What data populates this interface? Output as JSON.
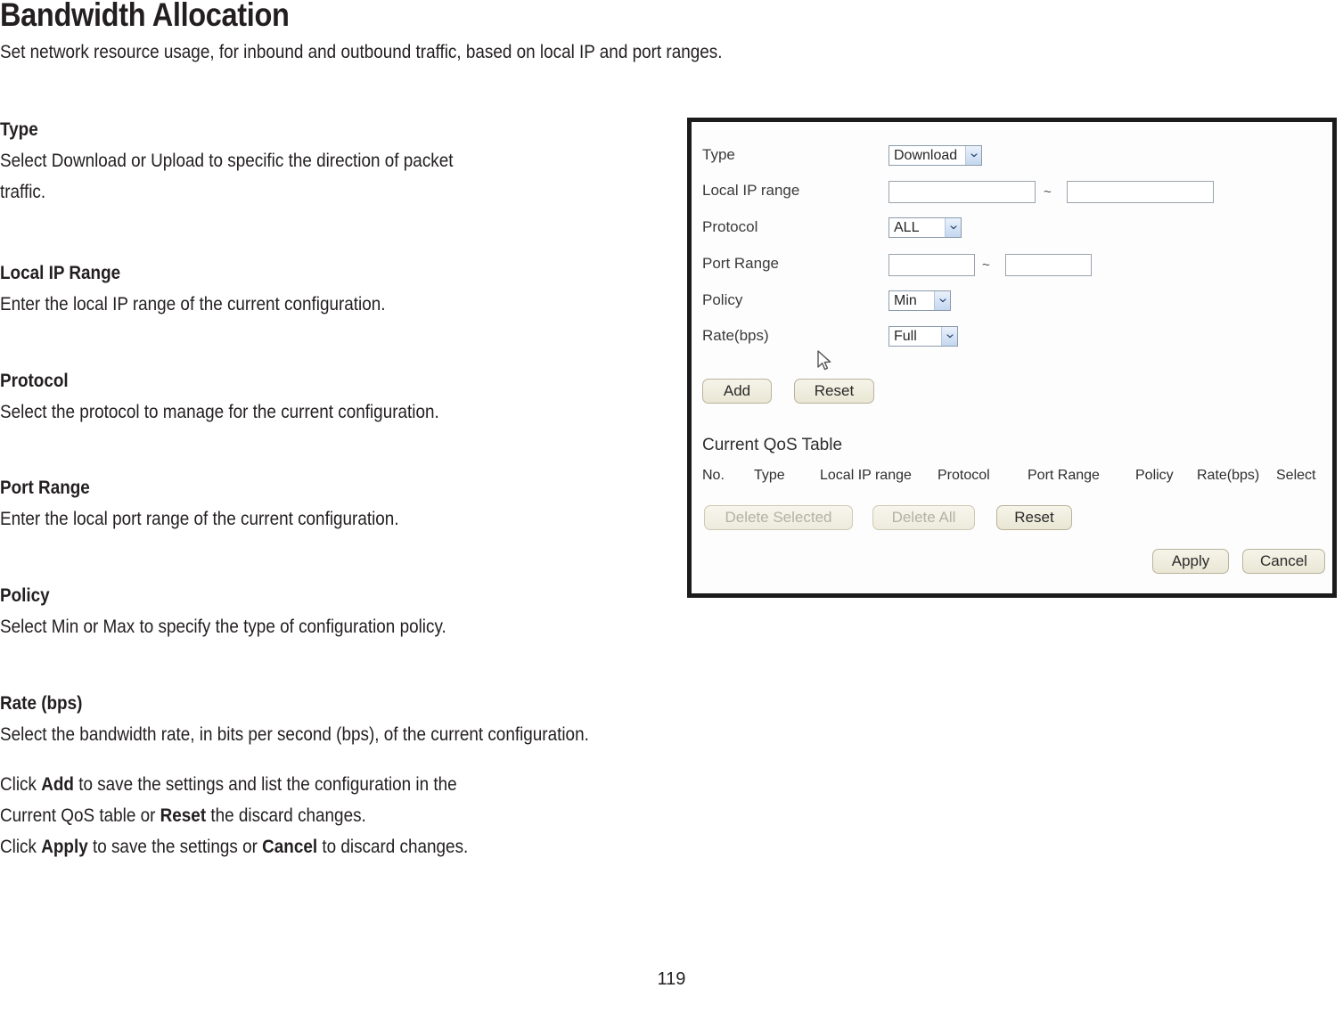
{
  "document": {
    "title": "Bandwidth Allocation",
    "subtitle": "Set network resource usage, for inbound and outbound traffic, based on local IP and port ranges.",
    "page_number": "119"
  },
  "sections": [
    {
      "heading": "Type",
      "lines": [
        "Select Download or Upload to specific the direction of packet",
        "traffic."
      ]
    },
    {
      "heading": "Local IP Range",
      "lines": [
        "Enter the local IP range of the current configuration."
      ]
    },
    {
      "heading": "Protocol",
      "lines": [
        "Select the protocol to manage for the current configuration."
      ]
    },
    {
      "heading": "Port Range",
      "lines": [
        "Enter the local port range of the current configuration."
      ]
    },
    {
      "heading": "Policy",
      "lines": [
        "Select Min or Max to specify the type of configuration policy."
      ]
    },
    {
      "heading": "Rate (bps)",
      "lines": [
        "Select the bandwidth rate, in bits per second (bps), of the current configuration."
      ]
    }
  ],
  "closing": {
    "line1_pre": "Click ",
    "line1_bold": "Add",
    "line1_post": " to save the settings and list the configuration in the",
    "line2_pre": "Current QoS table or ",
    "line2_bold": "Reset",
    "line2_post": " the discard changes.",
    "line3_pre": "Click ",
    "line3_bold1": "Apply",
    "line3_mid": " to save the settings or ",
    "line3_bold2": "Cancel",
    "line3_post": " to discard changes."
  },
  "screenshot": {
    "fields": {
      "type": {
        "label": "Type",
        "value": "Download"
      },
      "local_ip_range": {
        "label": "Local IP range",
        "from": "",
        "to": "",
        "separator": "~"
      },
      "protocol": {
        "label": "Protocol",
        "value": "ALL"
      },
      "port_range": {
        "label": "Port Range",
        "from": "",
        "to": "",
        "separator": "~"
      },
      "policy": {
        "label": "Policy",
        "value": "Min"
      },
      "rate": {
        "label": "Rate(bps)",
        "value": "Full"
      }
    },
    "form_buttons": {
      "add": "Add",
      "reset": "Reset"
    },
    "table": {
      "title": "Current QoS Table",
      "columns": [
        "No.",
        "Type",
        "Local IP range",
        "Protocol",
        "Port Range",
        "Policy",
        "Rate(bps)",
        "Select"
      ],
      "rows": []
    },
    "table_buttons": {
      "delete_selected": "Delete Selected",
      "delete_all": "Delete All",
      "reset": "Reset"
    },
    "footer_buttons": {
      "apply": "Apply",
      "cancel": "Cancel"
    },
    "colors": {
      "panel_border": "#1b1b1b",
      "button_face": "#efecdd",
      "select_arrow": "#c4d7ef",
      "text": "#2e2e2e"
    }
  }
}
